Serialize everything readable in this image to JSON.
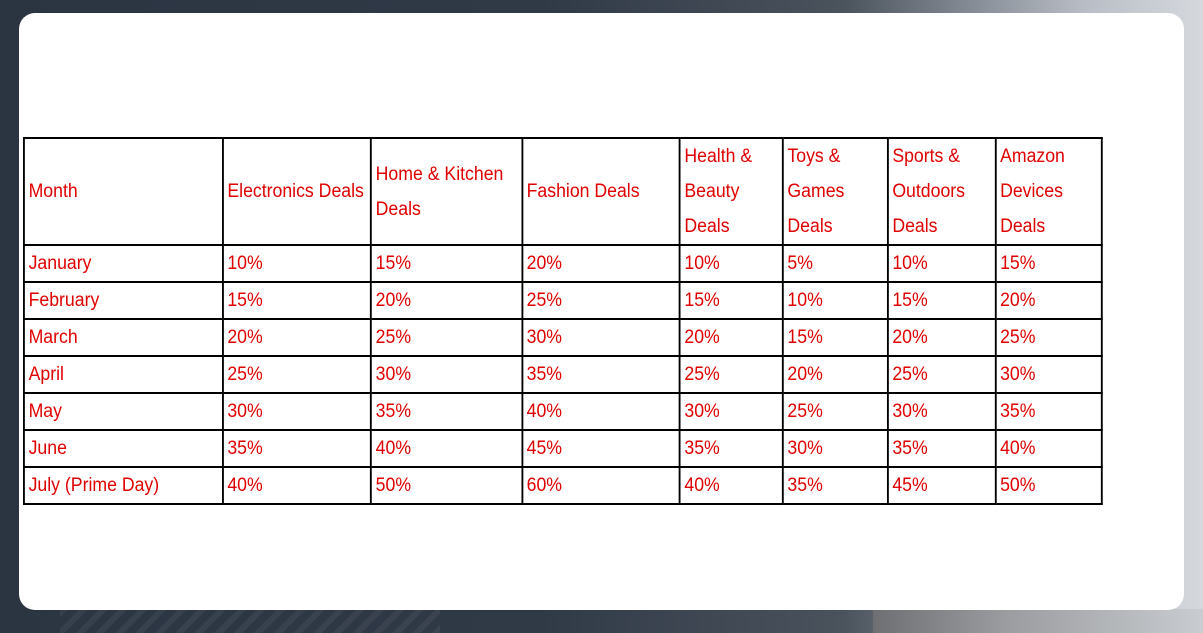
{
  "table": {
    "headers": [
      "Month",
      "Electronics Deals",
      "Home & Kitchen Deals",
      "Fashion Deals",
      "Health & Beauty Deals",
      "Toys & Games Deals",
      "Sports & Outdoors Deals",
      "Amazon Devices Deals"
    ],
    "rows": [
      [
        "January",
        "10%",
        "15%",
        "20%",
        "10%",
        "5%",
        "10%",
        "15%"
      ],
      [
        "February",
        "15%",
        "20%",
        "25%",
        "15%",
        "10%",
        "15%",
        "20%"
      ],
      [
        "March",
        "20%",
        "25%",
        "30%",
        "20%",
        "15%",
        "20%",
        "25%"
      ],
      [
        "April",
        "25%",
        "30%",
        "35%",
        "25%",
        "20%",
        "25%",
        "30%"
      ],
      [
        "May",
        "30%",
        "35%",
        "40%",
        "30%",
        "25%",
        "30%",
        "35%"
      ],
      [
        "June",
        "35%",
        "40%",
        "45%",
        "35%",
        "30%",
        "35%",
        "40%"
      ],
      [
        "July (Prime Day)",
        "40%",
        "50%",
        "60%",
        "40%",
        "35%",
        "45%",
        "50%"
      ]
    ]
  },
  "colors": {
    "text": "#e00000",
    "border": "#000000",
    "card": "#ffffff"
  }
}
